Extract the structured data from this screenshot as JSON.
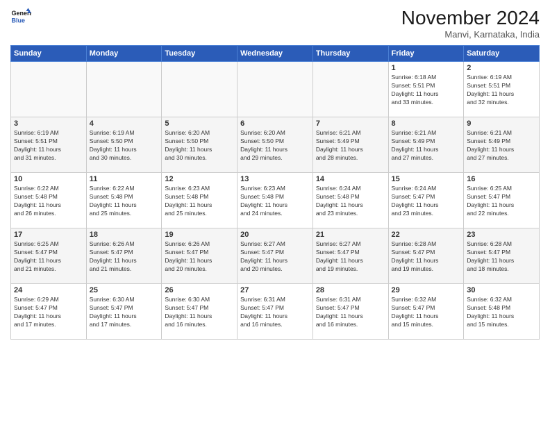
{
  "header": {
    "logo_line1": "General",
    "logo_line2": "Blue",
    "month_title": "November 2024",
    "subtitle": "Manvi, Karnataka, India"
  },
  "days_of_week": [
    "Sunday",
    "Monday",
    "Tuesday",
    "Wednesday",
    "Thursday",
    "Friday",
    "Saturday"
  ],
  "weeks": [
    [
      {
        "day": "",
        "info": ""
      },
      {
        "day": "",
        "info": ""
      },
      {
        "day": "",
        "info": ""
      },
      {
        "day": "",
        "info": ""
      },
      {
        "day": "",
        "info": ""
      },
      {
        "day": "1",
        "info": "Sunrise: 6:18 AM\nSunset: 5:51 PM\nDaylight: 11 hours\nand 33 minutes."
      },
      {
        "day": "2",
        "info": "Sunrise: 6:19 AM\nSunset: 5:51 PM\nDaylight: 11 hours\nand 32 minutes."
      }
    ],
    [
      {
        "day": "3",
        "info": "Sunrise: 6:19 AM\nSunset: 5:51 PM\nDaylight: 11 hours\nand 31 minutes."
      },
      {
        "day": "4",
        "info": "Sunrise: 6:19 AM\nSunset: 5:50 PM\nDaylight: 11 hours\nand 30 minutes."
      },
      {
        "day": "5",
        "info": "Sunrise: 6:20 AM\nSunset: 5:50 PM\nDaylight: 11 hours\nand 30 minutes."
      },
      {
        "day": "6",
        "info": "Sunrise: 6:20 AM\nSunset: 5:50 PM\nDaylight: 11 hours\nand 29 minutes."
      },
      {
        "day": "7",
        "info": "Sunrise: 6:21 AM\nSunset: 5:49 PM\nDaylight: 11 hours\nand 28 minutes."
      },
      {
        "day": "8",
        "info": "Sunrise: 6:21 AM\nSunset: 5:49 PM\nDaylight: 11 hours\nand 27 minutes."
      },
      {
        "day": "9",
        "info": "Sunrise: 6:21 AM\nSunset: 5:49 PM\nDaylight: 11 hours\nand 27 minutes."
      }
    ],
    [
      {
        "day": "10",
        "info": "Sunrise: 6:22 AM\nSunset: 5:48 PM\nDaylight: 11 hours\nand 26 minutes."
      },
      {
        "day": "11",
        "info": "Sunrise: 6:22 AM\nSunset: 5:48 PM\nDaylight: 11 hours\nand 25 minutes."
      },
      {
        "day": "12",
        "info": "Sunrise: 6:23 AM\nSunset: 5:48 PM\nDaylight: 11 hours\nand 25 minutes."
      },
      {
        "day": "13",
        "info": "Sunrise: 6:23 AM\nSunset: 5:48 PM\nDaylight: 11 hours\nand 24 minutes."
      },
      {
        "day": "14",
        "info": "Sunrise: 6:24 AM\nSunset: 5:48 PM\nDaylight: 11 hours\nand 23 minutes."
      },
      {
        "day": "15",
        "info": "Sunrise: 6:24 AM\nSunset: 5:47 PM\nDaylight: 11 hours\nand 23 minutes."
      },
      {
        "day": "16",
        "info": "Sunrise: 6:25 AM\nSunset: 5:47 PM\nDaylight: 11 hours\nand 22 minutes."
      }
    ],
    [
      {
        "day": "17",
        "info": "Sunrise: 6:25 AM\nSunset: 5:47 PM\nDaylight: 11 hours\nand 21 minutes."
      },
      {
        "day": "18",
        "info": "Sunrise: 6:26 AM\nSunset: 5:47 PM\nDaylight: 11 hours\nand 21 minutes."
      },
      {
        "day": "19",
        "info": "Sunrise: 6:26 AM\nSunset: 5:47 PM\nDaylight: 11 hours\nand 20 minutes."
      },
      {
        "day": "20",
        "info": "Sunrise: 6:27 AM\nSunset: 5:47 PM\nDaylight: 11 hours\nand 20 minutes."
      },
      {
        "day": "21",
        "info": "Sunrise: 6:27 AM\nSunset: 5:47 PM\nDaylight: 11 hours\nand 19 minutes."
      },
      {
        "day": "22",
        "info": "Sunrise: 6:28 AM\nSunset: 5:47 PM\nDaylight: 11 hours\nand 19 minutes."
      },
      {
        "day": "23",
        "info": "Sunrise: 6:28 AM\nSunset: 5:47 PM\nDaylight: 11 hours\nand 18 minutes."
      }
    ],
    [
      {
        "day": "24",
        "info": "Sunrise: 6:29 AM\nSunset: 5:47 PM\nDaylight: 11 hours\nand 17 minutes."
      },
      {
        "day": "25",
        "info": "Sunrise: 6:30 AM\nSunset: 5:47 PM\nDaylight: 11 hours\nand 17 minutes."
      },
      {
        "day": "26",
        "info": "Sunrise: 6:30 AM\nSunset: 5:47 PM\nDaylight: 11 hours\nand 16 minutes."
      },
      {
        "day": "27",
        "info": "Sunrise: 6:31 AM\nSunset: 5:47 PM\nDaylight: 11 hours\nand 16 minutes."
      },
      {
        "day": "28",
        "info": "Sunrise: 6:31 AM\nSunset: 5:47 PM\nDaylight: 11 hours\nand 16 minutes."
      },
      {
        "day": "29",
        "info": "Sunrise: 6:32 AM\nSunset: 5:47 PM\nDaylight: 11 hours\nand 15 minutes."
      },
      {
        "day": "30",
        "info": "Sunrise: 6:32 AM\nSunset: 5:48 PM\nDaylight: 11 hours\nand 15 minutes."
      }
    ]
  ]
}
